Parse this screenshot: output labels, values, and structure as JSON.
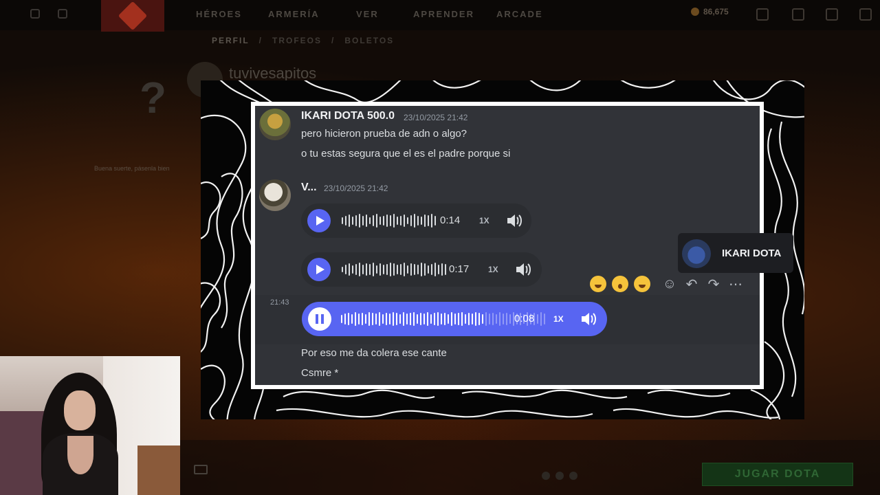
{
  "dota": {
    "nav": [
      "HÉROES",
      "ARMERÍA",
      "VER",
      "APRENDER",
      "ARCADE"
    ],
    "currency": "86,675",
    "subnav": [
      "PERFIL",
      "/",
      "TROFEOS",
      "/",
      "BOLETOS"
    ],
    "profile_name": "tuvivesapitos",
    "question_mark": "?",
    "luck_text": "Buena suerte, pásenla bien",
    "play_button": "JUGAR DOTA"
  },
  "discord": {
    "msg1": {
      "author": "IKARI DOTA 500.0",
      "timestamp": "23/10/2025 21:42",
      "lines": [
        "pero hicieron prueba de adn o algo?",
        "o tu estas segura que el es el padre porque si"
      ]
    },
    "msg2": {
      "author": "V...",
      "timestamp": "23/10/2025 21:42",
      "voice": [
        {
          "duration": "0:14",
          "speed": "1X",
          "state": "paused"
        },
        {
          "duration": "0:17",
          "speed": "1X",
          "state": "paused"
        },
        {
          "duration": "0:08",
          "speed": "1X",
          "state": "playing",
          "progress": 0.7
        }
      ],
      "side_time": "21:43",
      "lines": [
        "Por eso me da colera ese cante",
        "Csmre *"
      ]
    },
    "hover_toolbar": {
      "reactions": [
        "rolling-on-floor-laughing",
        "astonished",
        "pleading"
      ],
      "actions": [
        "add-reaction",
        "reply",
        "forward",
        "more"
      ]
    },
    "speaking_tag": "IKARI DOTA"
  },
  "colors": {
    "discord_bg": "#313338",
    "blurple": "#5865f2",
    "overlay_bg": "#050505"
  }
}
